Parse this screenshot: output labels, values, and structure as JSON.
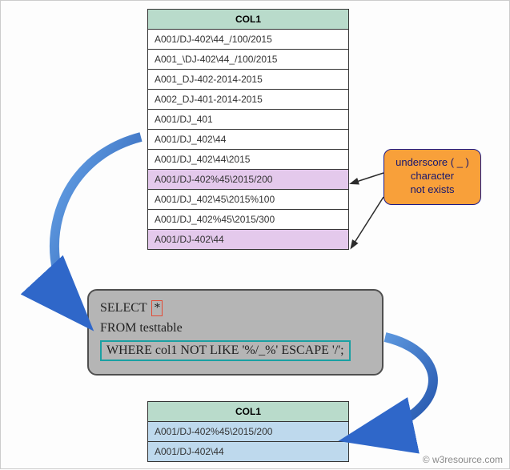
{
  "source_table": {
    "header": "COL1",
    "rows": [
      {
        "val": "A001/DJ-402\\44_/100/2015",
        "highlight": false
      },
      {
        "val": "A001_\\DJ-402\\44_/100/2015",
        "highlight": false
      },
      {
        "val": "A001_DJ-402-2014-2015",
        "highlight": false
      },
      {
        "val": "A002_DJ-401-2014-2015",
        "highlight": false
      },
      {
        "val": "A001/DJ_401",
        "highlight": false
      },
      {
        "val": "A001/DJ_402\\44",
        "highlight": false
      },
      {
        "val": "A001/DJ_402\\44\\2015",
        "highlight": false
      },
      {
        "val": "A001/DJ-402%45\\2015/200",
        "highlight": true
      },
      {
        "val": "A001/DJ_402\\45\\2015%100",
        "highlight": false
      },
      {
        "val": "A001/DJ_402%45\\2015/300",
        "highlight": false
      },
      {
        "val": "A001/DJ-402\\44",
        "highlight": true
      }
    ]
  },
  "result_table": {
    "header": "COL1",
    "rows": [
      {
        "val": "A001/DJ-402%45\\2015/200"
      },
      {
        "val": "A001/DJ-402\\44"
      }
    ]
  },
  "sql": {
    "select_kw": "SELECT",
    "star": "*",
    "from_line": "FROM testtable",
    "where_line": "WHERE col1   NOT LIKE '%/_%' ESCAPE '/';"
  },
  "callout": {
    "line1": "underscore ( _ )",
    "line2": "character",
    "line3": "not exists"
  },
  "footer": "© w3resource.com",
  "colors": {
    "arrow_blue": "#2f67c9",
    "pointer_dark": "#2b2b2b"
  }
}
